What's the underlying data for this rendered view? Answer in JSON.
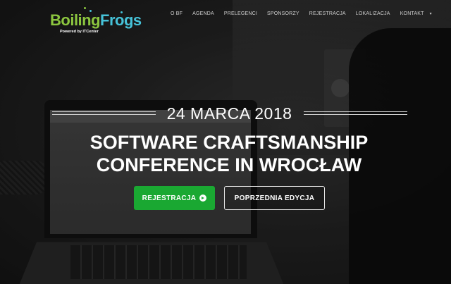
{
  "logo": {
    "name_part1": "Boiling",
    "name_part2": "Frogs",
    "tagline": "Powered by  ITCenter"
  },
  "nav": {
    "items": [
      "O BF",
      "AGENDA",
      "PRELEGENCI",
      "SPONSORZY",
      "REJESTRACJA",
      "LOKALIZACJA",
      "KONTAKT"
    ],
    "more_icon": "chevron-down-icon"
  },
  "hero": {
    "date": "24 MARCA 2018",
    "headline_line1": "SOFTWARE CRAFTSMANSHIP",
    "headline_line2": "CONFERENCE IN WROCŁAW",
    "register_button": "REJESTRACJA",
    "register_icon": "arrow-circle-right-icon",
    "previous_button": "POPRZEDNIA EDYCJA"
  },
  "colors": {
    "logo_green": "#8cc63f",
    "logo_blue": "#46c2d8",
    "register_green": "#1aa832",
    "text": "#ffffff"
  }
}
